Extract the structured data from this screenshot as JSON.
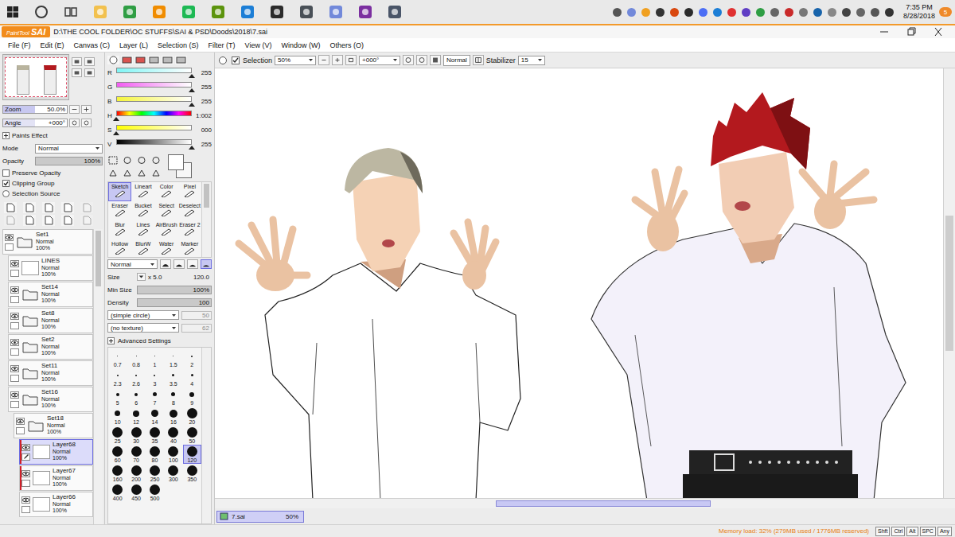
{
  "taskbar": {
    "time": "7:35 PM",
    "date": "8/28/2018",
    "notifications": "5"
  },
  "window": {
    "logo_small": "PaintTool",
    "logo_big": "SAI",
    "title": "D:\\THE COOL FOLDER\\OC STUFFS\\SAI & PSD\\Doods\\2018\\7.sai"
  },
  "menu": [
    "File (F)",
    "Edit (E)",
    "Canvas (C)",
    "Layer (L)",
    "Selection (S)",
    "Filter (T)",
    "View (V)",
    "Window (W)",
    "Others (O)"
  ],
  "navigator": {
    "zoom_label": "Zoom",
    "zoom": "50.0%",
    "zoom_level": 0.5,
    "angle_label": "Angle",
    "angle": "+000°",
    "angle_level": 0.5
  },
  "layer_props": {
    "paints_effect": "Paints Effect",
    "paints_effect_expanded": false,
    "mode_label": "Mode",
    "mode": "Normal",
    "opacity_label": "Opacity",
    "opacity": "100%",
    "opacity_level": 1,
    "options": [
      {
        "label": "Preserve Opacity",
        "kind": "checkbox",
        "checked": false
      },
      {
        "label": "Clipping Group",
        "kind": "checkbox",
        "checked": true
      },
      {
        "label": "Selection Source",
        "kind": "radio",
        "checked": false
      }
    ]
  },
  "layers": [
    {
      "name": "Set1",
      "kind": "folder",
      "mode": "Normal",
      "opacity": "100%",
      "visible": true,
      "depth": 0,
      "clipped": false,
      "selected": false
    },
    {
      "name": "LINES",
      "kind": "layer",
      "mode": "Normal",
      "opacity": "100%",
      "visible": true,
      "depth": 1,
      "clipped": false,
      "selected": false
    },
    {
      "name": "Set14",
      "kind": "folder",
      "mode": "Normal",
      "opacity": "100%",
      "visible": true,
      "depth": 1,
      "clipped": false,
      "selected": false
    },
    {
      "name": "Set8",
      "kind": "folder",
      "mode": "Normal",
      "opacity": "100%",
      "visible": true,
      "depth": 1,
      "clipped": false,
      "selected": false
    },
    {
      "name": "Set2",
      "kind": "folder",
      "mode": "Normal",
      "opacity": "100%",
      "visible": true,
      "depth": 1,
      "clipped": false,
      "selected": false
    },
    {
      "name": "Set11",
      "kind": "folder",
      "mode": "Normal",
      "opacity": "100%",
      "visible": true,
      "depth": 1,
      "clipped": false,
      "selected": false
    },
    {
      "name": "Set16",
      "kind": "folder",
      "mode": "Normal",
      "opacity": "100%",
      "visible": true,
      "depth": 1,
      "clipped": false,
      "selected": false
    },
    {
      "name": "Set18",
      "kind": "folder",
      "mode": "Normal",
      "opacity": "100%",
      "visible": true,
      "depth": 2,
      "clipped": false,
      "selected": false
    },
    {
      "name": "Layer68",
      "kind": "layer",
      "mode": "Normal",
      "opacity": "100%",
      "visible": true,
      "depth": 3,
      "clipped": true,
      "selected": true
    },
    {
      "name": "Layer67",
      "kind": "layer",
      "mode": "Normal",
      "opacity": "100%",
      "visible": true,
      "depth": 3,
      "clipped": true,
      "selected": false
    },
    {
      "name": "Layer66",
      "kind": "layer",
      "mode": "Normal",
      "opacity": "100%",
      "visible": true,
      "depth": 3,
      "clipped": false,
      "selected": false
    }
  ],
  "color": {
    "sliders": [
      {
        "name": "R",
        "value": "255",
        "level": 1,
        "kind": "gradient",
        "color": "#7ff5f5"
      },
      {
        "name": "G",
        "value": "255",
        "level": 1,
        "kind": "gradient",
        "color": "#f25cf2"
      },
      {
        "name": "B",
        "value": "255",
        "level": 1,
        "kind": "gradient",
        "color": "#f5f53a"
      },
      {
        "name": "H",
        "value": "1:002",
        "level": 0.0,
        "kind": "hue",
        "color": "#ff0000"
      },
      {
        "name": "S",
        "value": "000",
        "level": 0,
        "kind": "gradient",
        "color": "#ffff00"
      },
      {
        "name": "V",
        "value": "255",
        "level": 1,
        "kind": "value",
        "color": "#000000"
      }
    ]
  },
  "tools": [
    {
      "label": "Sketch",
      "selected": true
    },
    {
      "label": "Lineart",
      "selected": false
    },
    {
      "label": "Color",
      "selected": false
    },
    {
      "label": "Pixel",
      "selected": false
    },
    {
      "label": "Eraser",
      "selected": false
    },
    {
      "label": "Bucket",
      "selected": false
    },
    {
      "label": "Select",
      "selected": false
    },
    {
      "label": "Deselect",
      "selected": false
    },
    {
      "label": "Blur",
      "selected": false
    },
    {
      "label": "Lines",
      "selected": false
    },
    {
      "label": "AirBrush",
      "selected": false
    },
    {
      "label": "Eraser 2",
      "selected": false
    },
    {
      "label": "Hollow",
      "selected": false
    },
    {
      "label": "BlurW",
      "selected": false
    },
    {
      "label": "Water",
      "selected": false
    },
    {
      "label": "Marker",
      "selected": false
    }
  ],
  "brush": {
    "blend": "Normal",
    "size_label": "Size",
    "size_mult": "x 5.0",
    "size": "120.0",
    "min_size_label": "Min Size",
    "min_size": "100%",
    "min_size_level": 1,
    "density_label": "Density",
    "density": "100",
    "density_level": 1,
    "shape": "(simple circle)",
    "shape_value": "50",
    "shape_disabled": true,
    "texture": "(no texture)",
    "texture_value": "62",
    "texture_disabled": true,
    "advanced": "Advanced Settings",
    "advanced_expanded": false
  },
  "brush_sizes": [
    {
      "label": "0.7",
      "selected": false
    },
    {
      "label": "0.8",
      "selected": false
    },
    {
      "label": "1",
      "selected": false
    },
    {
      "label": "1.5",
      "selected": false
    },
    {
      "label": "2",
      "selected": false
    },
    {
      "label": "2.3",
      "selected": false
    },
    {
      "label": "2.6",
      "selected": false
    },
    {
      "label": "3",
      "selected": false
    },
    {
      "label": "3.5",
      "selected": false
    },
    {
      "label": "4",
      "selected": false
    },
    {
      "label": "5",
      "selected": false
    },
    {
      "label": "6",
      "selected": false
    },
    {
      "label": "7",
      "selected": false
    },
    {
      "label": "8",
      "selected": false
    },
    {
      "label": "9",
      "selected": false
    },
    {
      "label": "10",
      "selected": false
    },
    {
      "label": "12",
      "selected": false
    },
    {
      "label": "14",
      "selected": false
    },
    {
      "label": "16",
      "selected": false
    },
    {
      "label": "20",
      "selected": false
    },
    {
      "label": "25",
      "selected": false
    },
    {
      "label": "30",
      "selected": false
    },
    {
      "label": "35",
      "selected": false
    },
    {
      "label": "40",
      "selected": false
    },
    {
      "label": "50",
      "selected": false
    },
    {
      "label": "60",
      "selected": false
    },
    {
      "label": "70",
      "selected": false
    },
    {
      "label": "80",
      "selected": false
    },
    {
      "label": "100",
      "selected": false
    },
    {
      "label": "120",
      "selected": true
    },
    {
      "label": "160",
      "selected": false
    },
    {
      "label": "200",
      "selected": false
    },
    {
      "label": "250",
      "selected": false
    },
    {
      "label": "300",
      "selected": false
    },
    {
      "label": "350",
      "selected": false
    },
    {
      "label": "400",
      "selected": false
    },
    {
      "label": "450",
      "selected": false
    },
    {
      "label": "500",
      "selected": false
    }
  ],
  "canvas_toolbar": {
    "selection_label": "Selection",
    "selection_checked": true,
    "zoom": "50%",
    "angle": "+000°",
    "blend": "Normal",
    "stabilizer_label": "Stabilizer",
    "stabilizer": "15"
  },
  "documents": [
    {
      "name": "7.sai",
      "zoom": "50%",
      "selected": true
    }
  ],
  "status": {
    "memory": "Memory load: 32% (279MB used / 1776MB reserved)",
    "keys": [
      "Shft",
      "Ctrl",
      "Alt",
      "SPC",
      "Any"
    ]
  }
}
